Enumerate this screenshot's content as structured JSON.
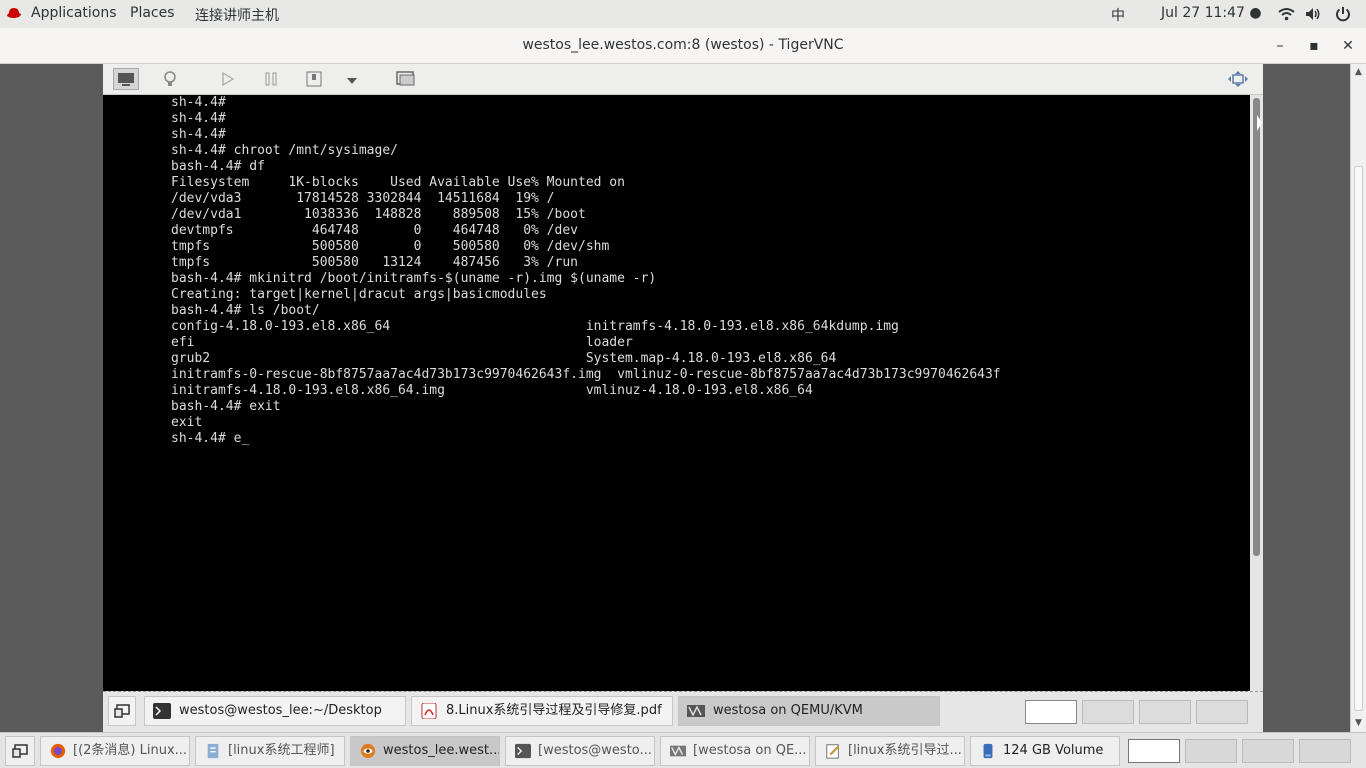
{
  "topbar": {
    "applications": "Applications",
    "places": "Places",
    "connect": "连接讲师主机",
    "input_method": "中",
    "clock": "Jul 27  11:47 ●"
  },
  "window": {
    "title": "westos_lee.westos.com:8 (westos) - TigerVNC",
    "minimize": "–",
    "maximize": "▪",
    "close": "✕"
  },
  "terminal": {
    "lines": [
      "sh-4.4#",
      "sh-4.4#",
      "sh-4.4#",
      "sh-4.4# chroot /mnt/sysimage/",
      "bash-4.4# df",
      "Filesystem     1K-blocks    Used Available Use% Mounted on",
      "/dev/vda3       17814528 3302844  14511684  19% /",
      "/dev/vda1        1038336  148828    889508  15% /boot",
      "devtmpfs          464748       0    464748   0% /dev",
      "tmpfs             500580       0    500580   0% /dev/shm",
      "tmpfs             500580   13124    487456   3% /run",
      "bash-4.4# mkinitrd /boot/initramfs-$(uname -r).img $(uname -r)",
      "Creating: target|kernel|dracut args|basicmodules",
      "bash-4.4# ls /boot/",
      "config-4.18.0-193.el8.x86_64                         initramfs-4.18.0-193.el8.x86_64kdump.img",
      "efi                                                  loader",
      "grub2                                                System.map-4.18.0-193.el8.x86_64",
      "initramfs-0-rescue-8bf8757aa7ac4d73b173c9970462643f.img  vmlinuz-0-rescue-8bf8757aa7ac4d73b173c9970462643f",
      "initramfs-4.18.0-193.el8.x86_64.img                  vmlinuz-4.18.0-193.el8.x86_64",
      "bash-4.4# exit",
      "exit",
      "sh-4.4# e_"
    ]
  },
  "guest_taskbar": {
    "tasks": [
      {
        "label": "westos@westos_lee:~/Desktop"
      },
      {
        "label": "8.Linux系统引导过程及引导修复.pdf"
      },
      {
        "label": "westosa on QEMU/KVM"
      }
    ]
  },
  "host_taskbar": {
    "tasks": [
      {
        "label": "[(2条消息) Linux..."
      },
      {
        "label": "[linux系统工程师]"
      },
      {
        "label": "westos_lee.west..."
      },
      {
        "label": "[westos@westo..."
      },
      {
        "label": "[westosa on QE..."
      },
      {
        "label": "[linux系统引导过..."
      },
      {
        "label": "124 GB Volume"
      }
    ]
  },
  "colors": {
    "terminal_bg": "#000000",
    "terminal_fg": "#dcdcdc",
    "topbar_bg": "#e8e8e7",
    "accent_red": "#cc0000"
  }
}
